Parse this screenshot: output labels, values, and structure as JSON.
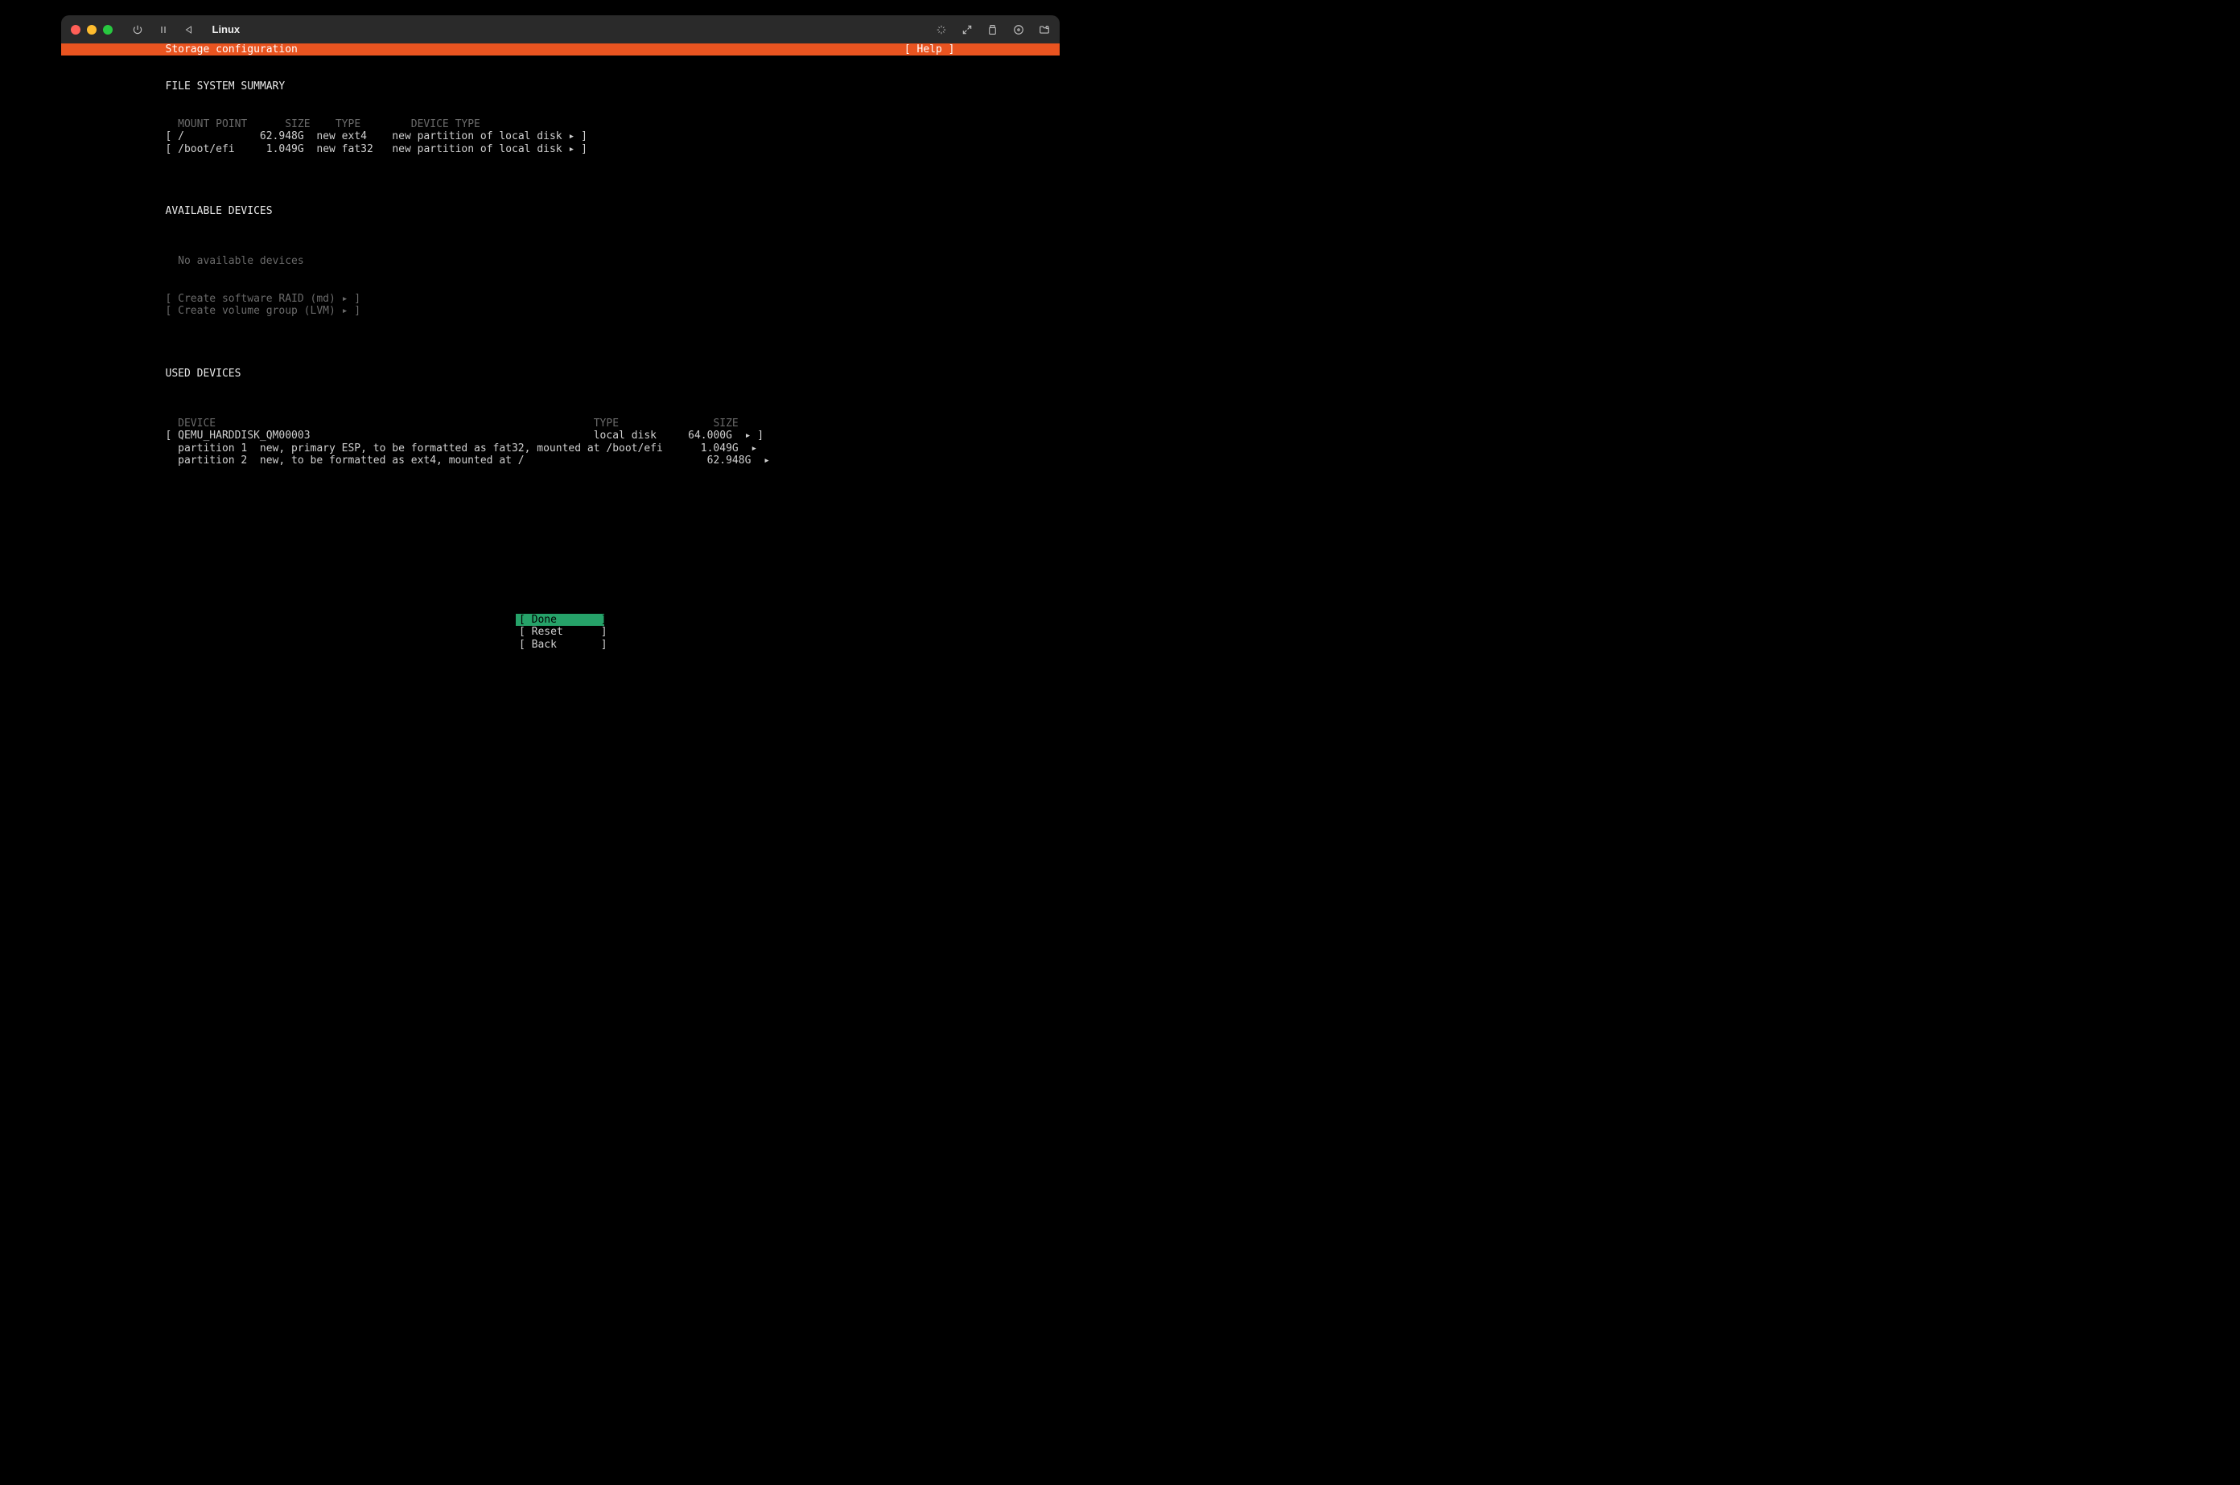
{
  "titlebar": {
    "vm_name": "Linux"
  },
  "header": {
    "title": "Storage configuration",
    "help": "[ Help ]"
  },
  "fs_summary": {
    "heading": "FILE SYSTEM SUMMARY",
    "cols": {
      "mount": "MOUNT POINT",
      "size": "SIZE",
      "type": "TYPE",
      "devtype": "DEVICE TYPE"
    },
    "rows": [
      {
        "mount": "/",
        "size": "62.948G",
        "type": "new ext4",
        "devtype": "new partition of local disk"
      },
      {
        "mount": "/boot/efi",
        "size": "1.049G",
        "type": "new fat32",
        "devtype": "new partition of local disk"
      }
    ]
  },
  "available": {
    "heading": "AVAILABLE DEVICES",
    "empty": "No available devices",
    "raid": "[ Create software RAID (md) ▸ ]",
    "lvm": "[ Create volume group (LVM) ▸ ]"
  },
  "used": {
    "heading": "USED DEVICES",
    "cols": {
      "device": "DEVICE",
      "type": "TYPE",
      "size": "SIZE"
    },
    "disk": {
      "name": "QEMU_HARDDISK_QM00003",
      "type": "local disk",
      "size": "64.000G"
    },
    "parts": [
      {
        "name": "partition 1",
        "desc": "new, primary ESP, to be formatted as fat32, mounted at /boot/efi",
        "size": "1.049G"
      },
      {
        "name": "partition 2",
        "desc": "new, to be formatted as ext4, mounted at /",
        "size": "62.948G"
      }
    ]
  },
  "footer": {
    "done": "[ Done       ]",
    "reset": "[ Reset      ]",
    "back": "[ Back       ]"
  }
}
